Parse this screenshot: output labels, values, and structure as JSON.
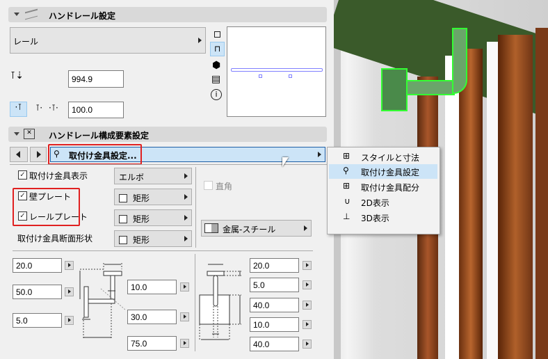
{
  "section1": {
    "title": "ハンドレール設定",
    "rail_select": "レール",
    "height_value": "994.9",
    "offset_value": "100.0"
  },
  "section2": {
    "title": "ハンドレール構成要素設定",
    "nav_select": "取付け金具設定..."
  },
  "menu": {
    "items": [
      {
        "label": "スタイルと寸法",
        "icon": "railing-style-icon"
      },
      {
        "label": "取付け金具設定",
        "icon": "bracket-icon",
        "selected": true
      },
      {
        "label": "取付け金具配分",
        "icon": "distribution-icon"
      },
      {
        "label": "2D表示",
        "icon": "2d-pen-icon"
      },
      {
        "label": "3D表示",
        "icon": "3d-brush-icon"
      }
    ]
  },
  "options": {
    "show_bracket": "取付け金具表示",
    "wall_plate": "壁プレート",
    "rail_plate": "レールプレート",
    "section_shape_label": "取付け金具断面形状",
    "elbow": "エルボ",
    "shape1": "矩形",
    "shape2": "矩形",
    "shape3": "矩形",
    "right_angle": "直角",
    "material": "金属-スチール"
  },
  "dims": {
    "left": [
      "20.0",
      "50.0",
      "5.0"
    ],
    "middle": [
      "10.0",
      "30.0",
      "75.0"
    ],
    "right": [
      "20.0",
      "5.0",
      "40.0",
      "10.0",
      "40.0"
    ]
  }
}
